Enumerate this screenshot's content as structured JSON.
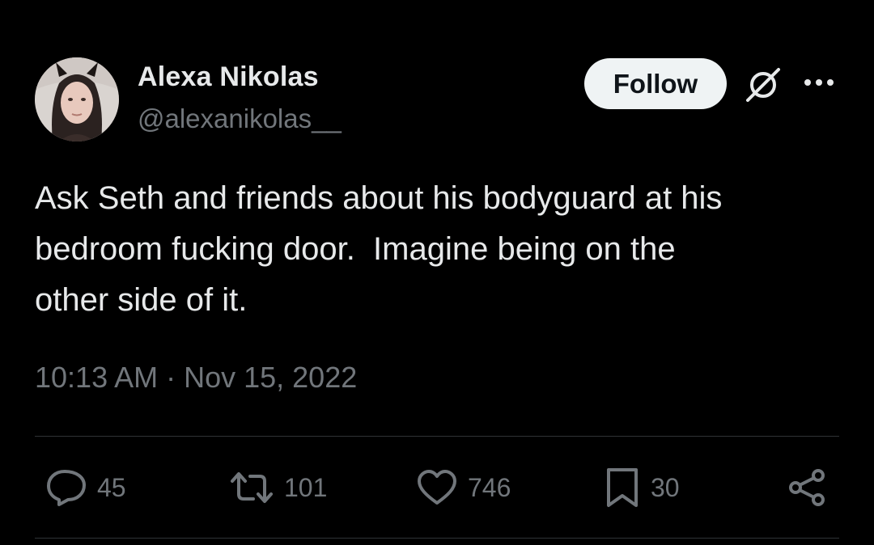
{
  "author": {
    "display_name": "Alexa Nikolas",
    "handle": "@alexanikolas__"
  },
  "header": {
    "follow_label": "Follow",
    "grok_icon": "grok-icon",
    "more_icon": "more-icon"
  },
  "tweet": {
    "text": "Ask Seth and friends about his bodyguard at his\nbedroom fucking door.  Imagine being on the\nother side of it.",
    "timestamp": "10:13 AM · Nov 15, 2022"
  },
  "actions": {
    "replies": "45",
    "reposts": "101",
    "likes": "746",
    "bookmarks": "30",
    "share_icon": "share-icon"
  },
  "colors": {
    "background": "#000000",
    "primary_text": "#e7e9ea",
    "secondary_text": "#71767b",
    "divider": "#2f3336",
    "follow_button_bg": "#eff3f4"
  }
}
